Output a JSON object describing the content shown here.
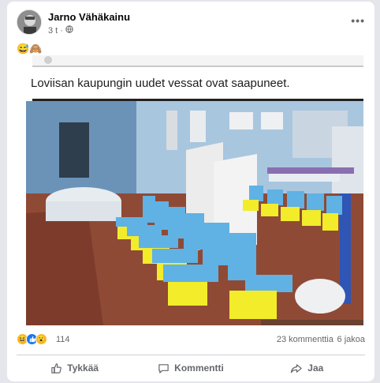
{
  "post": {
    "author": "Jarno Vähäkainu",
    "time": "3 t",
    "emojis": "😅🙈",
    "shared_text": "Loviisan kaupungin uudet vessat ovat saapuneet."
  },
  "stats": {
    "reactions_count": "114",
    "comments": "23 kommenttia",
    "shares": "6 jakoa"
  },
  "actions": {
    "like": "Tykkää",
    "comment": "Kommentti",
    "share": "Jaa"
  },
  "colors": {
    "toilet_top": "#5aaee0",
    "toilet_bottom": "#e8e62a"
  }
}
